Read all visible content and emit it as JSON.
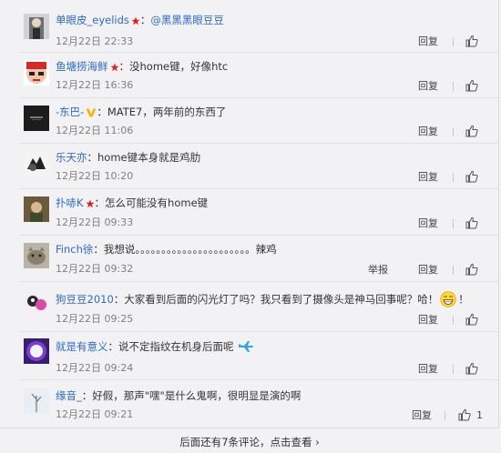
{
  "comments": [
    {
      "user": "单眼皮_eyelids",
      "badge": "star",
      "content_prefix": "：",
      "mention": "@黑黑黑眼豆豆",
      "content": "",
      "time": "12月22日 22:33",
      "reply_label": "回复"
    },
    {
      "user": "鱼塘捞海鲜",
      "badge": "star",
      "content_prefix": "：",
      "mention": "",
      "content": "没home键，好像htc",
      "time": "12月22日 16:36",
      "reply_label": "回复"
    },
    {
      "user": "-东巴-",
      "badge": "v",
      "content_prefix": "：",
      "mention": "",
      "content": "MATE7，两年前的东西了",
      "time": "12月22日 11:06",
      "reply_label": "回复"
    },
    {
      "user": "乐天亦",
      "badge": "",
      "content_prefix": "：",
      "mention": "",
      "content": "home键本身就是鸡肋",
      "time": "12月22日 10:20",
      "reply_label": "回复"
    },
    {
      "user": "扑哧K",
      "badge": "star",
      "content_prefix": "：",
      "mention": "",
      "content": "怎么可能没有home键",
      "time": "12月22日 09:33",
      "reply_label": "回复"
    },
    {
      "user": "Finch徐",
      "badge": "",
      "content_prefix": "：",
      "mention": "",
      "content": "我想说。。。。。。。。。。。。。。。。。。。。。。辣鸡",
      "time": "12月22日 09:32",
      "report_label": "举报",
      "reply_label": "回复"
    },
    {
      "user": "狗豆豆2010",
      "badge": "",
      "content_prefix": "：",
      "mention": "",
      "content": "大家看到后面的闪光灯了吗？我只看到了摄像头是神马回事呢？哈！",
      "content_suffix": "！",
      "time": "12月22日 09:25",
      "reply_label": "回复"
    },
    {
      "user": "就是有意义",
      "badge": "",
      "content_prefix": "：",
      "mention": "",
      "content": "说不定指纹在机身后面呢",
      "time": "12月22日 09:24",
      "reply_label": "回复"
    },
    {
      "user": "缘音_",
      "badge": "",
      "content_prefix": "：",
      "mention": "",
      "content": "好假，那声\"嘿\"是什么鬼啊，很明显是演的啊",
      "time": "12月22日 09:21",
      "reply_label": "回复",
      "like_count": "1"
    }
  ],
  "more_text": "后面还有7条评论，点击查看 ›",
  "colors": {
    "user_link": "#2d6ac0",
    "star_badge": "#e02020",
    "v_badge": "#f5b400"
  }
}
